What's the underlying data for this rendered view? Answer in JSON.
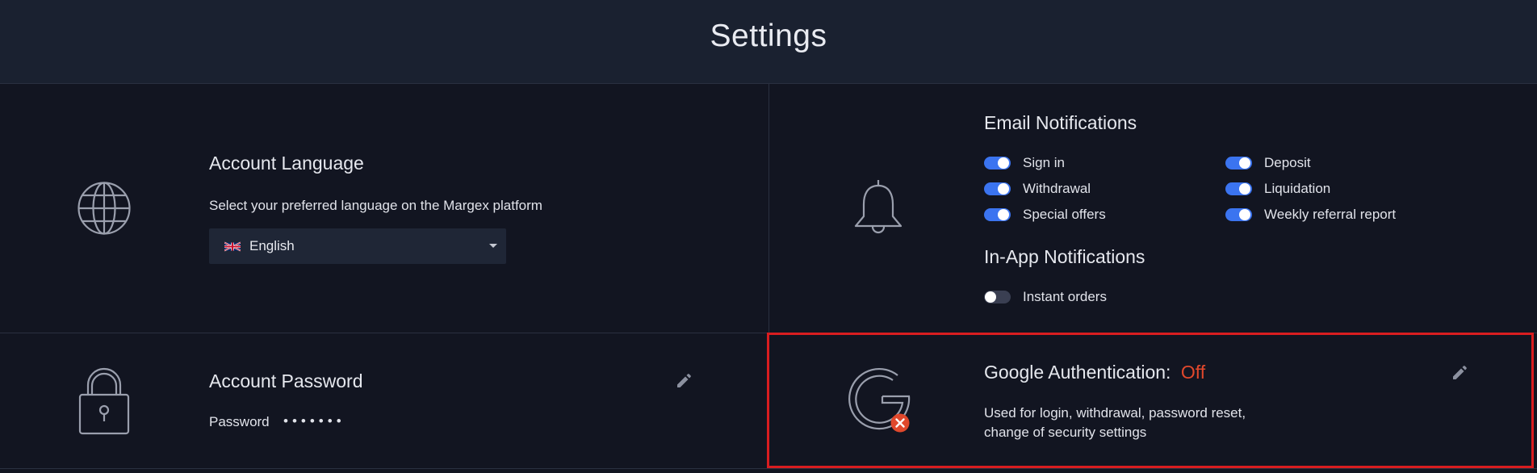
{
  "header": {
    "title": "Settings"
  },
  "language": {
    "title": "Account Language",
    "description": "Select your preferred language on the Margex platform",
    "selected": "English"
  },
  "notifications": {
    "email_title": "Email Notifications",
    "email_items": [
      {
        "label": "Sign in",
        "on": true
      },
      {
        "label": "Deposit",
        "on": true
      },
      {
        "label": "Withdrawal",
        "on": true
      },
      {
        "label": "Liquidation",
        "on": true
      },
      {
        "label": "Special offers",
        "on": true
      },
      {
        "label": "Weekly referral report",
        "on": true
      }
    ],
    "inapp_title": "In-App Notifications",
    "inapp_items": [
      {
        "label": "Instant orders",
        "on": false
      }
    ]
  },
  "password": {
    "title": "Account Password",
    "label": "Password",
    "masked": "•••••••"
  },
  "google_auth": {
    "title": "Google Authentication:",
    "status": "Off",
    "description_line1": "Used for login, withdrawal, password reset,",
    "description_line2": "change of security settings"
  },
  "colors": {
    "background": "#121521",
    "header": "#1a2130",
    "toggle_on": "#3b74f0",
    "toggle_off": "#3a3f52",
    "status_off": "#e0482c",
    "highlight": "#d91d20"
  },
  "icons": [
    "globe-icon",
    "bell-icon",
    "lock-icon",
    "google-icon",
    "error-badge-icon",
    "pencil-icon",
    "uk-flag-icon",
    "caret-down-icon"
  ]
}
